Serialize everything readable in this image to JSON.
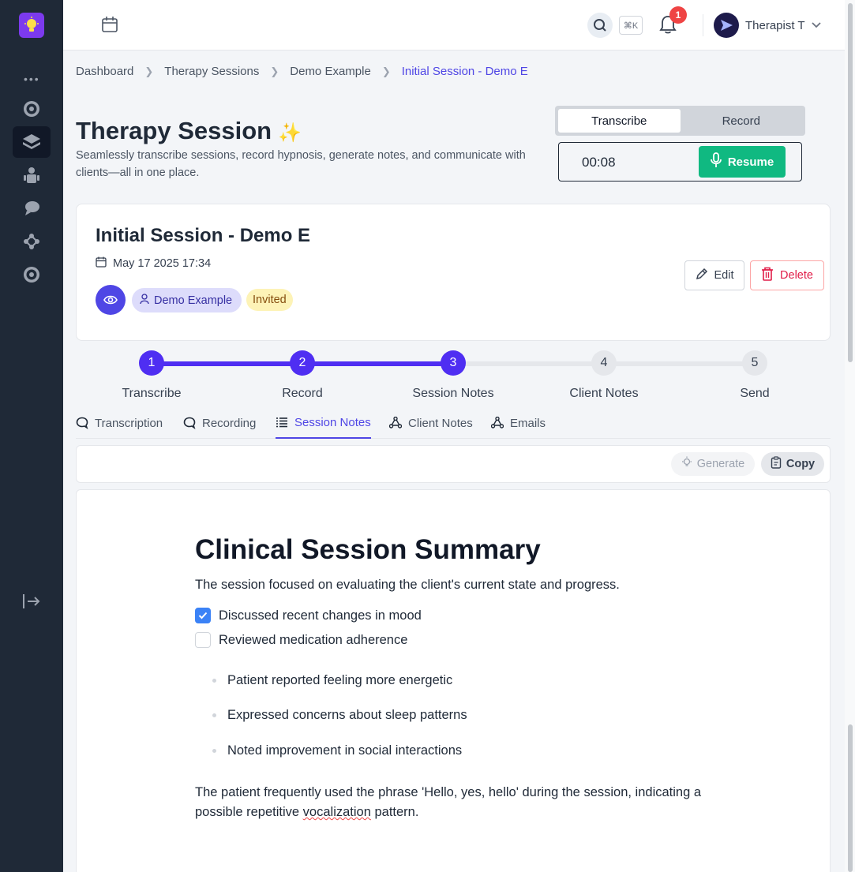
{
  "topbar": {
    "shortcut": "⌘K",
    "notification_count": "1",
    "user_name": "Therapist T"
  },
  "breadcrumb": [
    "Dashboard",
    "Therapy Sessions",
    "Demo Example",
    "Initial Session - Demo E"
  ],
  "header": {
    "title": "Therapy Session",
    "sparkle": "✨",
    "subtitle": "Seamlessly transcribe sessions, record hypnosis, generate notes, and communicate with clients—all in one place."
  },
  "mode_toggle": {
    "transcribe": "Transcribe",
    "record": "Record",
    "selected": "Transcribe"
  },
  "recorder": {
    "timer": "00:08",
    "resume_label": "Resume"
  },
  "session": {
    "title": "Initial Session - Demo E",
    "date": "May 17 2025 17:34",
    "client": "Demo Example",
    "status": "Invited",
    "edit_label": "Edit",
    "delete_label": "Delete"
  },
  "stepper": {
    "current_step": 3,
    "steps": [
      {
        "num": "1",
        "label": "Transcribe"
      },
      {
        "num": "2",
        "label": "Record"
      },
      {
        "num": "3",
        "label": "Session Notes"
      },
      {
        "num": "4",
        "label": "Client Notes"
      },
      {
        "num": "5",
        "label": "Send"
      }
    ]
  },
  "tabs": {
    "active": "Session Notes",
    "items": [
      "Transcription",
      "Recording",
      "Session Notes",
      "Client Notes",
      "Emails"
    ]
  },
  "toolbar": {
    "generate_label": "Generate",
    "copy_label": "Copy"
  },
  "document": {
    "title": "Clinical Session Summary",
    "intro": "The session focused on evaluating the client's current state and progress.",
    "checklist": [
      {
        "text": "Discussed recent changes in mood",
        "checked": true
      },
      {
        "text": "Reviewed medication adherence",
        "checked": false
      }
    ],
    "bullets": [
      "Patient reported feeling more energetic",
      "Expressed concerns about sleep patterns",
      "Noted improvement in social interactions"
    ],
    "paragraph_before": "The patient frequently used the phrase 'Hello, yes, hello' during the session, indicating a possible repetitive ",
    "paragraph_flagged_word": "vocalization",
    "paragraph_after": " pattern."
  },
  "colors": {
    "sidebar_bg": "#1f2937",
    "accent": "#4f46e5",
    "stepper_done": "#4f2ef2",
    "resume_green": "#10b981",
    "delete_red": "#e11d48",
    "checkbox_blue": "#3b82f6"
  },
  "icons": {
    "sidebar": [
      "app-logo-icon",
      "more-dots-icon",
      "dashboard-icon",
      "sessions-icon",
      "clients-icon",
      "messages-icon",
      "network-icon",
      "settings-icon",
      "collapse-sidebar-icon"
    ],
    "topbar": [
      "calendar-icon",
      "search-icon",
      "bell-icon",
      "avatar-icon",
      "chevron-down-icon"
    ]
  }
}
